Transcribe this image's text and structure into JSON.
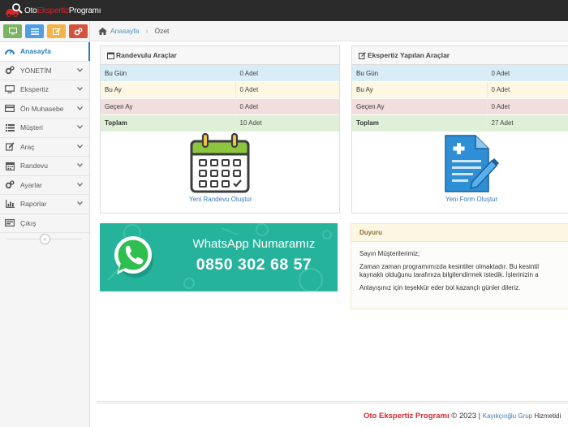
{
  "brand": {
    "part1": "Oto",
    "part2": "Ekspertiz",
    "part3": "Programı"
  },
  "sidebar": {
    "shortcuts": [
      {
        "icon": "desktop-icon",
        "color": "#7ab361"
      },
      {
        "icon": "list-icon",
        "color": "#4f9de5"
      },
      {
        "icon": "edit-icon",
        "color": "#f2b448"
      },
      {
        "icon": "cogs-icon",
        "color": "#d2543e"
      }
    ],
    "items": [
      {
        "label": "Anasayfa",
        "icon": "dashboard-icon",
        "active": true
      },
      {
        "label": "YÖNETİM",
        "icon": "cogs-icon"
      },
      {
        "label": "Ekspertiz",
        "icon": "desktop-icon"
      },
      {
        "label": "Ön Muhasebe",
        "icon": "credit-card-icon"
      },
      {
        "label": "Müşteri",
        "icon": "list-icon"
      },
      {
        "label": "Araç",
        "icon": "edit-icon"
      },
      {
        "label": "Randevu",
        "icon": "calendar-icon"
      },
      {
        "label": "Ayarlar",
        "icon": "cogs-icon"
      },
      {
        "label": "Raporlar",
        "icon": "bar-chart-icon"
      },
      {
        "label": "Çıkış",
        "icon": "logout-icon"
      }
    ],
    "collapse_glyph": "«"
  },
  "breadcrumb": {
    "home": "Anasayfa",
    "current": "Özet"
  },
  "randevu": {
    "title": "Randevulu Araçlar",
    "rows": [
      {
        "label": "Bu Gün",
        "value": "0 Adet"
      },
      {
        "label": "Bu Ay",
        "value": "0 Adet"
      },
      {
        "label": "Geçen Ay",
        "value": "0 Adet"
      },
      {
        "label": "Toplam",
        "value": "10 Adet"
      }
    ],
    "link": "Yeni Randevu Oluştur"
  },
  "ekspertiz": {
    "title": "Ekspertiz Yapılan Araçlar",
    "rows": [
      {
        "label": "Bu Gün",
        "value": "0 Adet"
      },
      {
        "label": "Bu Ay",
        "value": "0 Adet"
      },
      {
        "label": "Geçen Ay",
        "value": "0 Adet"
      },
      {
        "label": "Toplam",
        "value": "27 Adet"
      }
    ],
    "link": "Yeni Form Oluştur"
  },
  "whatsapp": {
    "line1": "WhatsApp Numaramız",
    "line2": "0850 302 68 57",
    "color": "#26b39b"
  },
  "duyuru": {
    "title": "Duyuru",
    "greeting": "Sayın Müşterilerimiz;",
    "line1": "Zaman zaman programımızda kesintiler olmaktadır. Bu kesintil",
    "line2": "kaynaklı olduğunu tarafınıza bilgilendirmek istedik. İşlerinizin a",
    "line3": "Anlayışınız için teşekkür eder bol kazançlı günler dileriz."
  },
  "footer": {
    "brand": "Oto Ekspertiz Programı",
    "copyright": " © 2023 | ",
    "company": "Kayıkçıoğlu Grup",
    "rest": " Hizmetidi"
  }
}
